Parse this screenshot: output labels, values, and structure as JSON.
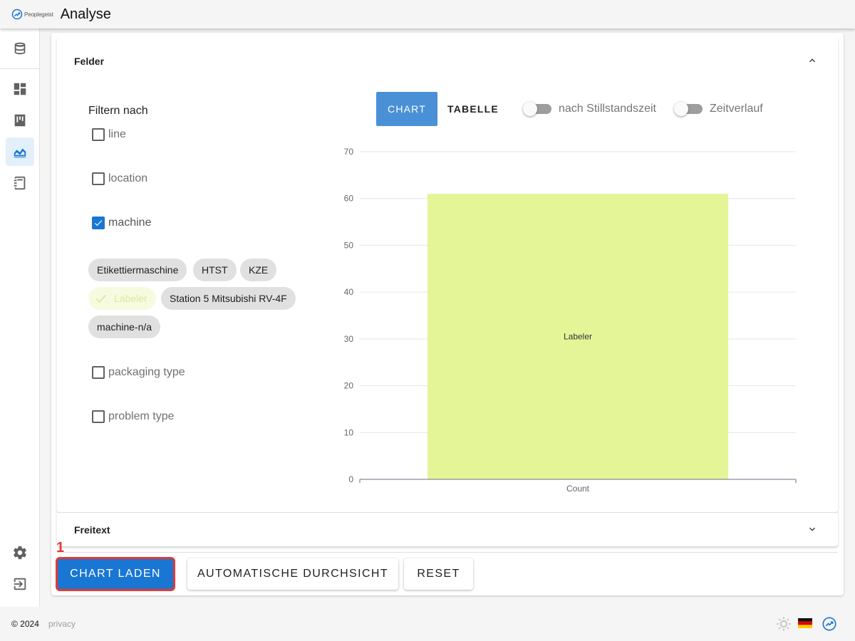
{
  "header": {
    "brand": "Peoplegeist",
    "title": "Analyse"
  },
  "nav": {
    "items": [
      {
        "name": "database-icon",
        "active": false
      },
      {
        "name": "dashboard-icon",
        "active": false
      },
      {
        "name": "board-icon",
        "active": false
      },
      {
        "name": "chart-area-icon",
        "active": true
      },
      {
        "name": "notebook-icon",
        "active": false
      },
      {
        "name": "gear-icon",
        "active": false
      },
      {
        "name": "logout-icon",
        "active": false
      }
    ]
  },
  "felder": {
    "title": "Felder",
    "filter_label": "Filtern nach",
    "checkboxes": {
      "line": {
        "label": "line",
        "checked": false
      },
      "location": {
        "label": "location",
        "checked": false
      },
      "machine": {
        "label": "machine",
        "checked": true
      },
      "packaging": {
        "label": "packaging type",
        "checked": false
      },
      "problem": {
        "label": "problem type",
        "checked": false
      }
    },
    "chips": [
      "Etikettiermaschine",
      "HTST",
      "KZE",
      "Labeler",
      "Station 5 Mitsubishi RV-4F",
      "machine-n/a"
    ],
    "selected_chip": "Labeler"
  },
  "view": {
    "chart_tab": "CHART",
    "table_tab": "TABELLE",
    "active_tab": "CHART",
    "toggle_downtime": "nach Stillstandszeit",
    "toggle_timeline": "Zeitverlauf",
    "toggle_downtime_on": false,
    "toggle_timeline_on": false
  },
  "chart_data": {
    "type": "bar",
    "categories": [
      "Count"
    ],
    "series": [
      {
        "name": "Labeler",
        "values": [
          61
        ],
        "color": "#e4f598"
      }
    ],
    "ylim": [
      0,
      70
    ],
    "yticks": [
      0,
      10,
      20,
      30,
      40,
      50,
      60,
      70
    ],
    "grid": true,
    "title": "",
    "xlabel": "",
    "ylabel": ""
  },
  "freitext": {
    "title": "Freitext"
  },
  "actions": {
    "load": "CHART LADEN",
    "auto": "AUTOMATISCHE DURCHSICHT",
    "reset": "RESET",
    "annotation": "1"
  },
  "footer": {
    "copyright": "© 2024",
    "privacy": "privacy"
  },
  "colors": {
    "primary": "#1976d2",
    "tab_active": "#4a90d6",
    "bar": "#e4f598",
    "highlight": "#e53935"
  }
}
